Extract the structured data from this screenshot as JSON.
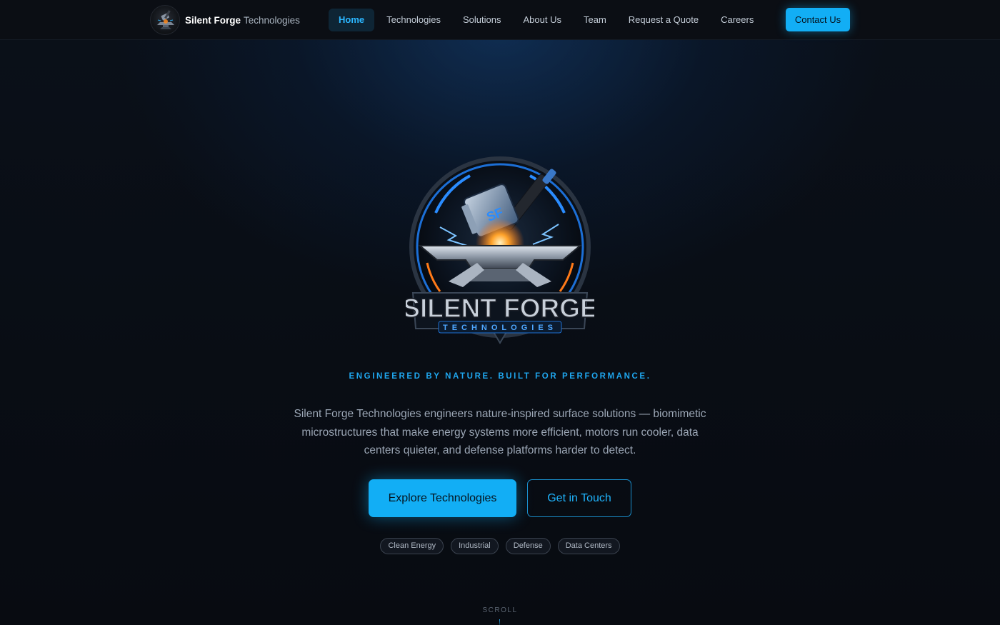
{
  "brand": {
    "name_strong": "Silent Forge",
    "name_light": "Technologies",
    "logo_icon": "anvil-hammer-emblem-icon"
  },
  "nav": {
    "items": [
      {
        "label": "Home",
        "active": true
      },
      {
        "label": "Technologies",
        "active": false
      },
      {
        "label": "Solutions",
        "active": false
      },
      {
        "label": "About Us",
        "active": false
      },
      {
        "label": "Team",
        "active": false
      },
      {
        "label": "Request a Quote",
        "active": false
      },
      {
        "label": "Careers",
        "active": false
      }
    ],
    "contact_label": "Contact Us"
  },
  "hero": {
    "logo_text_main": "SILENT FORGE",
    "logo_text_sub": "TECHNOLOGIES",
    "logo_mark": "SF",
    "tagline": "ENGINEERED BY NATURE. BUILT FOR PERFORMANCE.",
    "lead": "Silent Forge Technologies engineers nature-inspired surface solutions — biomimetic microstructures that make energy systems more efficient, motors run cooler, data centers quieter, and defense platforms harder to detect.",
    "primary_cta": "Explore Technologies",
    "secondary_cta": "Get in Touch",
    "tags": [
      "Clean Energy",
      "Industrial",
      "Defense",
      "Data Centers"
    ],
    "scroll_label": "SCROLL"
  },
  "colors": {
    "accent": "#12aef5",
    "background": "#080b11",
    "tagline": "#1fa6ee",
    "spark_orange": "#ff8a1c"
  }
}
